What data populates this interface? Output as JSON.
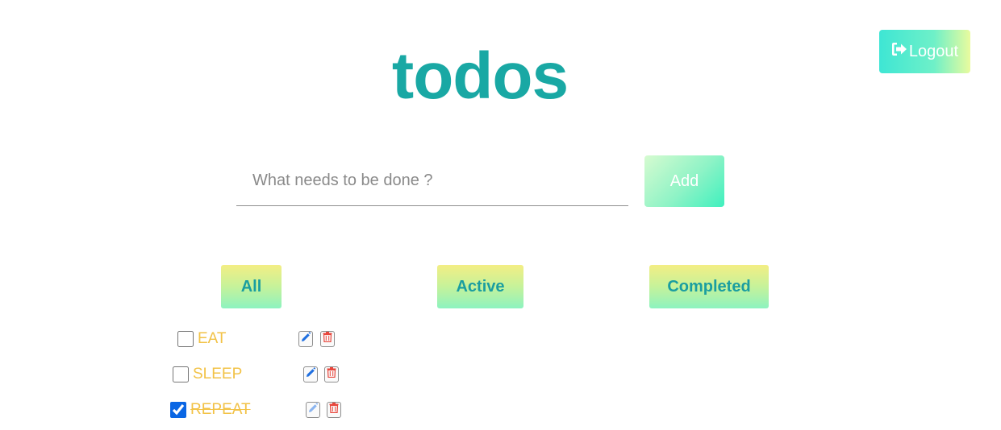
{
  "header": {
    "title": "todos",
    "logout_label": "Logout",
    "logout_icon": "sign-out-icon"
  },
  "input": {
    "placeholder": "What needs to be done ?",
    "value": "",
    "add_label": "Add"
  },
  "filters": [
    {
      "label": "All"
    },
    {
      "label": "Active"
    },
    {
      "label": "Completed"
    }
  ],
  "todos": [
    {
      "text": "EAT",
      "completed": false,
      "edit_icon": "pencil-icon",
      "delete_icon": "trash-icon"
    },
    {
      "text": "SLEEP",
      "completed": false,
      "edit_icon": "pencil-icon",
      "delete_icon": "trash-icon"
    },
    {
      "text": "REPEAT",
      "completed": true,
      "edit_icon": "pencil-icon",
      "delete_icon": "trash-icon"
    }
  ],
  "colors": {
    "title": "#19a8a4",
    "todo_text": "#f2c246",
    "edit_icon": "#1f6fe0",
    "delete_icon": "#e8463c"
  }
}
